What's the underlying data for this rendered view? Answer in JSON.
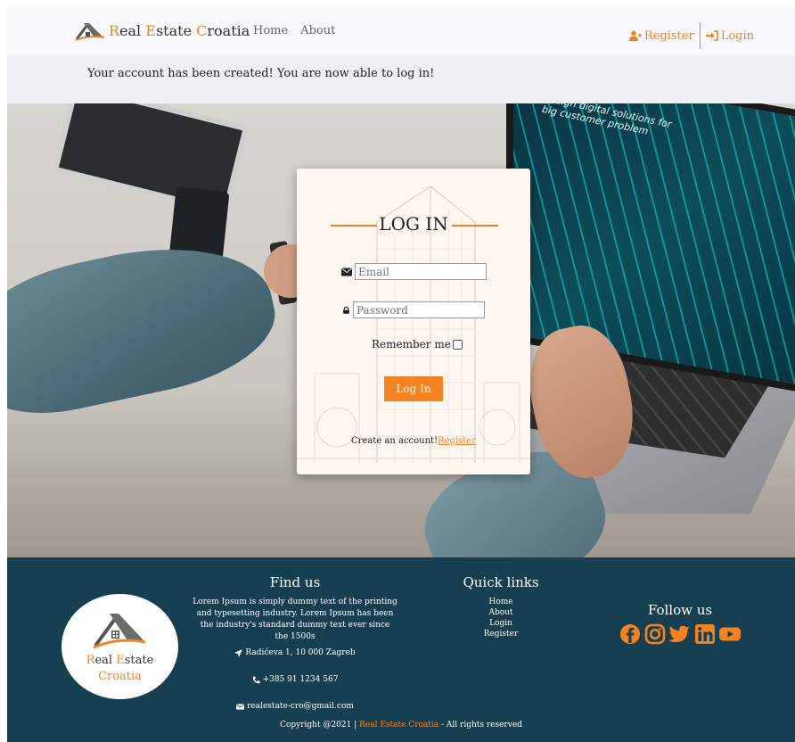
{
  "brand": {
    "part1": "R",
    "part2": "eal ",
    "part3": "E",
    "part4": "state ",
    "part5": "C",
    "part6": "roatia"
  },
  "nav": {
    "home": "Home",
    "about": "About",
    "register": "Register",
    "login": "Login"
  },
  "alert": {
    "message": "Your account has been created! You are now able to log in!"
  },
  "hero": {
    "screen_text_line1": "design digital solutions for",
    "screen_text_line2": "big customer problem"
  },
  "login": {
    "title": "LOG IN",
    "email_placeholder": "Email",
    "password_placeholder": "Password",
    "remember": "Remember me",
    "button": "Log In",
    "create_text": "Create an account!",
    "register_link": "Register"
  },
  "footer": {
    "logo_line1_accent": "R",
    "logo_line1_rest": "eal ",
    "logo_line1_accent2": "E",
    "logo_line1_rest2": "state",
    "logo_line2": "Croatia",
    "find_title": "Find us",
    "find_text": "Lorem Ipsum is simply dummy text of the printing and typesetting industry. Lorem Ipsum has been the industry's standard dummy text ever since the 1500s",
    "address": "Radićeva 1, 10 000 Zagreb",
    "phone": "+385 91 1234 567",
    "email": "realestate-cro@gmail.com",
    "quick_title": "Quick links",
    "quick_links": [
      "Home",
      "About",
      "Login",
      "Register"
    ],
    "follow_title": "Follow us",
    "copy_prefix": "Copyright @2021 | ",
    "copy_brand": "Real Estate Croatia",
    "copy_suffix": " - All rights reserved"
  },
  "colors": {
    "accent": "#f58220",
    "footer_bg": "#173f52",
    "navbar_bg": "#f8f9fa"
  },
  "icons": {
    "register": "user-plus-icon",
    "login": "sign-in-icon",
    "email": "envelope-icon",
    "password": "lock-icon",
    "address": "location-arrow-icon",
    "phone": "phone-icon",
    "mail": "envelope-icon",
    "socials": [
      "facebook-icon",
      "instagram-icon",
      "twitter-icon",
      "linkedin-icon",
      "youtube-icon"
    ]
  }
}
